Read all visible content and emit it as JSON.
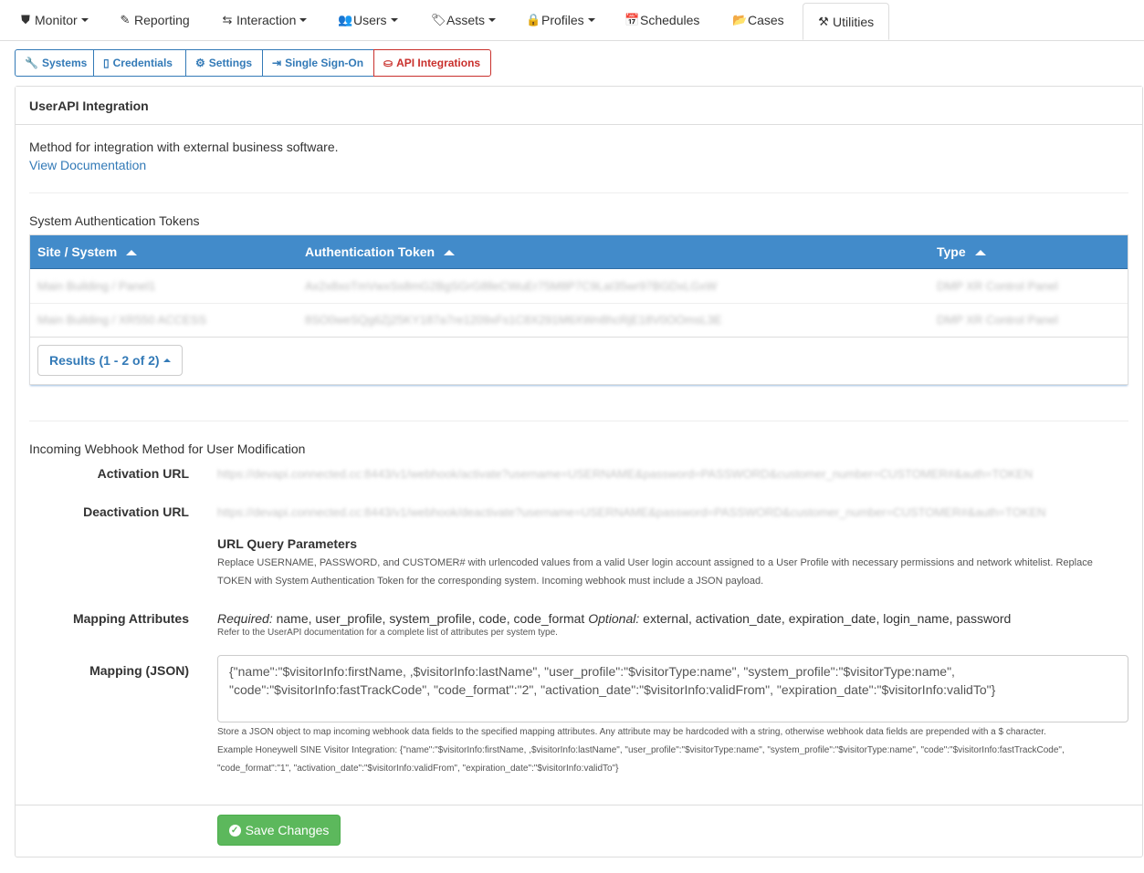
{
  "nav": {
    "monitor": "Monitor",
    "reporting": "Reporting",
    "interaction": "Interaction",
    "users": "Users",
    "assets": "Assets",
    "profiles": "Profiles",
    "schedules": "Schedules",
    "cases": "Cases",
    "utilities": "Utilities"
  },
  "subtabs": {
    "systems": "Systems",
    "credentials": "Credentials",
    "settings": "Settings",
    "sso": "Single Sign-On",
    "api": "API Integrations"
  },
  "panel": {
    "title": "UserAPI Integration",
    "description": "Method for integration with external business software.",
    "doc_link": "View Documentation"
  },
  "tokens": {
    "heading": "System Authentication Tokens",
    "columns": [
      "Site / System",
      "Authentication Token",
      "Type"
    ],
    "rows": [
      [
        "Main Building / Panel1",
        "Ax2x8xoTmVwxSs8mG2BgSGrG8lleCWuEr75M8P7C9LaI35wr97BGDxLGxW",
        "DMP XR Control Panel"
      ],
      [
        "Main Building / XR550 ACCESS",
        "8SO0weSQg6Zj25KY187a7re1209xFs1C8X291M6XWn8hcRjE18V0OOmsL3E",
        "DMP XR Control Panel"
      ]
    ],
    "results": "Results (1 - 2 of 2)"
  },
  "webhook": {
    "heading": "Incoming Webhook Method for User Modification",
    "activation_label": "Activation URL",
    "activation_url": "https://devapi.connected.cc:8443/v1/webhook/activate?username=USERNAME&password=PASSWORD&customer_number=CUSTOMER#&auth=TOKEN",
    "deactivation_label": "Deactivation URL",
    "deactivation_url": "https://devapi.connected.cc:8443/v1/webhook/deactivate?username=USERNAME&password=PASSWORD&customer_number=CUSTOMER#&auth=TOKEN",
    "params_title": "URL Query Parameters",
    "params_text": "Replace USERNAME, PASSWORD, and CUSTOMER# with urlencoded values from a valid User login account assigned to a User Profile with necessary permissions and network whitelist. Replace TOKEN with System Authentication Token for the corresponding system. Incoming webhook must include a JSON payload.",
    "mapping_label": "Mapping Attributes",
    "required_label": "Required:",
    "required_attrs": "name, user_profile, system_profile, code, code_format",
    "optional_label": "Optional:",
    "optional_attrs": "external, activation_date, expiration_date, login_name, password",
    "mapping_note": "Refer to the UserAPI documentation for a complete list of attributes per system type.",
    "json_label": "Mapping (JSON)",
    "json_value": "{\"name\":\"$visitorInfo:firstName, ,$visitorInfo:lastName\", \"user_profile\":\"$visitorType:name\", \"system_profile\":\"$visitorType:name\", \"code\":\"$visitorInfo:fastTrackCode\", \"code_format\":\"2\", \"activation_date\":\"$visitorInfo:validFrom\", \"expiration_date\":\"$visitorInfo:validTo\"}",
    "json_help": "Store a JSON object to map incoming webhook data fields to the specified mapping attributes. Any attribute may be hardcoded with a string, otherwise webhook data fields are prepended with a $ character.",
    "json_example": "Example Honeywell SINE Visitor Integration: {\"name\":\"$visitorInfo:firstName, ,$visitorInfo:lastName\", \"user_profile\":\"$visitorType:name\", \"system_profile\":\"$visitorType:name\", \"code\":\"$visitorInfo:fastTrackCode\", \"code_format\":\"1\", \"activation_date\":\"$visitorInfo:validFrom\", \"expiration_date\":\"$visitorInfo:validTo\"}"
  },
  "save_label": "Save Changes"
}
